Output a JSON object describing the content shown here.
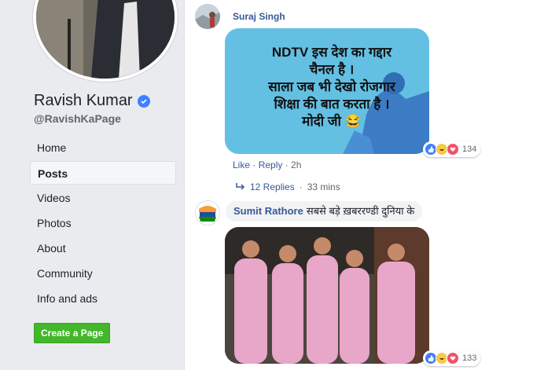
{
  "sidebar": {
    "page_name": "Ravish Kumar",
    "handle": "@RavishKaPage",
    "nav": [
      "Home",
      "Posts",
      "Videos",
      "Photos",
      "About",
      "Community",
      "Info and ads"
    ],
    "active_index": 1,
    "create_page_label": "Create a Page"
  },
  "comments": [
    {
      "author": "Suraj Singh",
      "meme_lines": [
        "NDTV  इस देश का गद्दार",
        "चैनल है ।",
        "साला जब भी  देखो  रोजगार",
        "शिक्षा की बात करता है ।",
        "मोदी जी 😂"
      ],
      "reaction_count": "134",
      "actions": {
        "like": "Like",
        "reply": "Reply",
        "time": "2h"
      },
      "replies": {
        "label": "12 Replies",
        "time": "33 mins"
      }
    },
    {
      "author": "Sumit Rathore",
      "text": "सबसे बड़े ख़बररण्डी दुनिया के",
      "reaction_count": "133"
    }
  ],
  "colors": {
    "link": "#385898",
    "sidebar_bg": "#e9ebee",
    "create_btn": "#42b72a"
  }
}
